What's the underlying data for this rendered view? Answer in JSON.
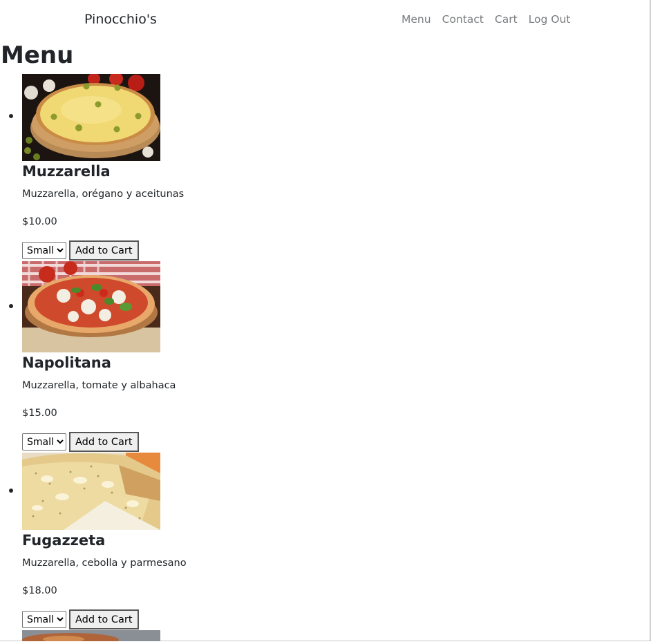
{
  "navbar": {
    "brand": "Pinocchio's",
    "links": [
      "Menu",
      "Contact",
      "Cart",
      "Log Out"
    ]
  },
  "page": {
    "title": "Menu"
  },
  "menu": {
    "items": [
      {
        "name": "Muzzarella",
        "description": "Muzzarella, orégano y aceitunas",
        "price": "$10.00",
        "size": "Small",
        "button": "Add to Cart"
      },
      {
        "name": "Napolitana",
        "description": "Muzzarella, tomate y albahaca",
        "price": "$15.00",
        "size": "Small",
        "button": "Add to Cart"
      },
      {
        "name": "Fugazzeta",
        "description": "Muzzarella, cebolla y parmesano",
        "price": "$18.00",
        "size": "Small",
        "button": "Add to Cart"
      }
    ]
  }
}
